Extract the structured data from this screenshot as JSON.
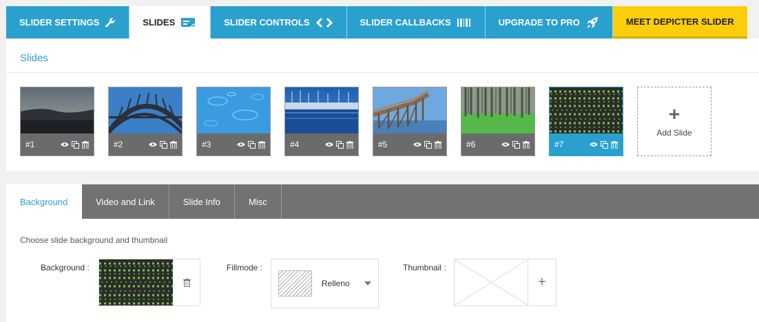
{
  "top_tabs": [
    {
      "label": "SLIDER SETTINGS",
      "icon": "wrench-icon"
    },
    {
      "label": "SLIDES",
      "icon": "slides-icon",
      "active": true
    },
    {
      "label": "SLIDER CONTROLS",
      "icon": "code-arrows-icon"
    },
    {
      "label": "SLIDER CALLBACKS",
      "icon": "barcode-icon"
    },
    {
      "label": "UPGRADE TO PRO",
      "icon": "rocket-icon"
    },
    {
      "label": "MEET DEPICTER SLIDER",
      "icon": ""
    }
  ],
  "slides_panel": {
    "title": "Slides",
    "slides": [
      {
        "num": "#1",
        "scene": "dusk-sky"
      },
      {
        "num": "#2",
        "scene": "steel-bridge"
      },
      {
        "num": "#3",
        "scene": "water-ripples"
      },
      {
        "num": "#4",
        "scene": "harbor-boats"
      },
      {
        "num": "#5",
        "scene": "wooden-bridge"
      },
      {
        "num": "#6",
        "scene": "forest"
      },
      {
        "num": "#7",
        "scene": "crop-field",
        "active": true
      }
    ],
    "add_label": "Add Slide"
  },
  "settings": {
    "tabs": [
      "Background",
      "Video and Link",
      "Slide Info",
      "Misc"
    ],
    "hint": "Choose slide background and thumbnail",
    "background_label": "Background :",
    "fillmode_label": "Fillmode :",
    "fillmode_value": "Relleno",
    "thumbnail_label": "Thumbnail :"
  },
  "colors": {
    "accent": "#2aa0cf",
    "promo": "#fcce0c",
    "subtab_bar": "#727272",
    "slide_bar": "#6b6b6b"
  }
}
